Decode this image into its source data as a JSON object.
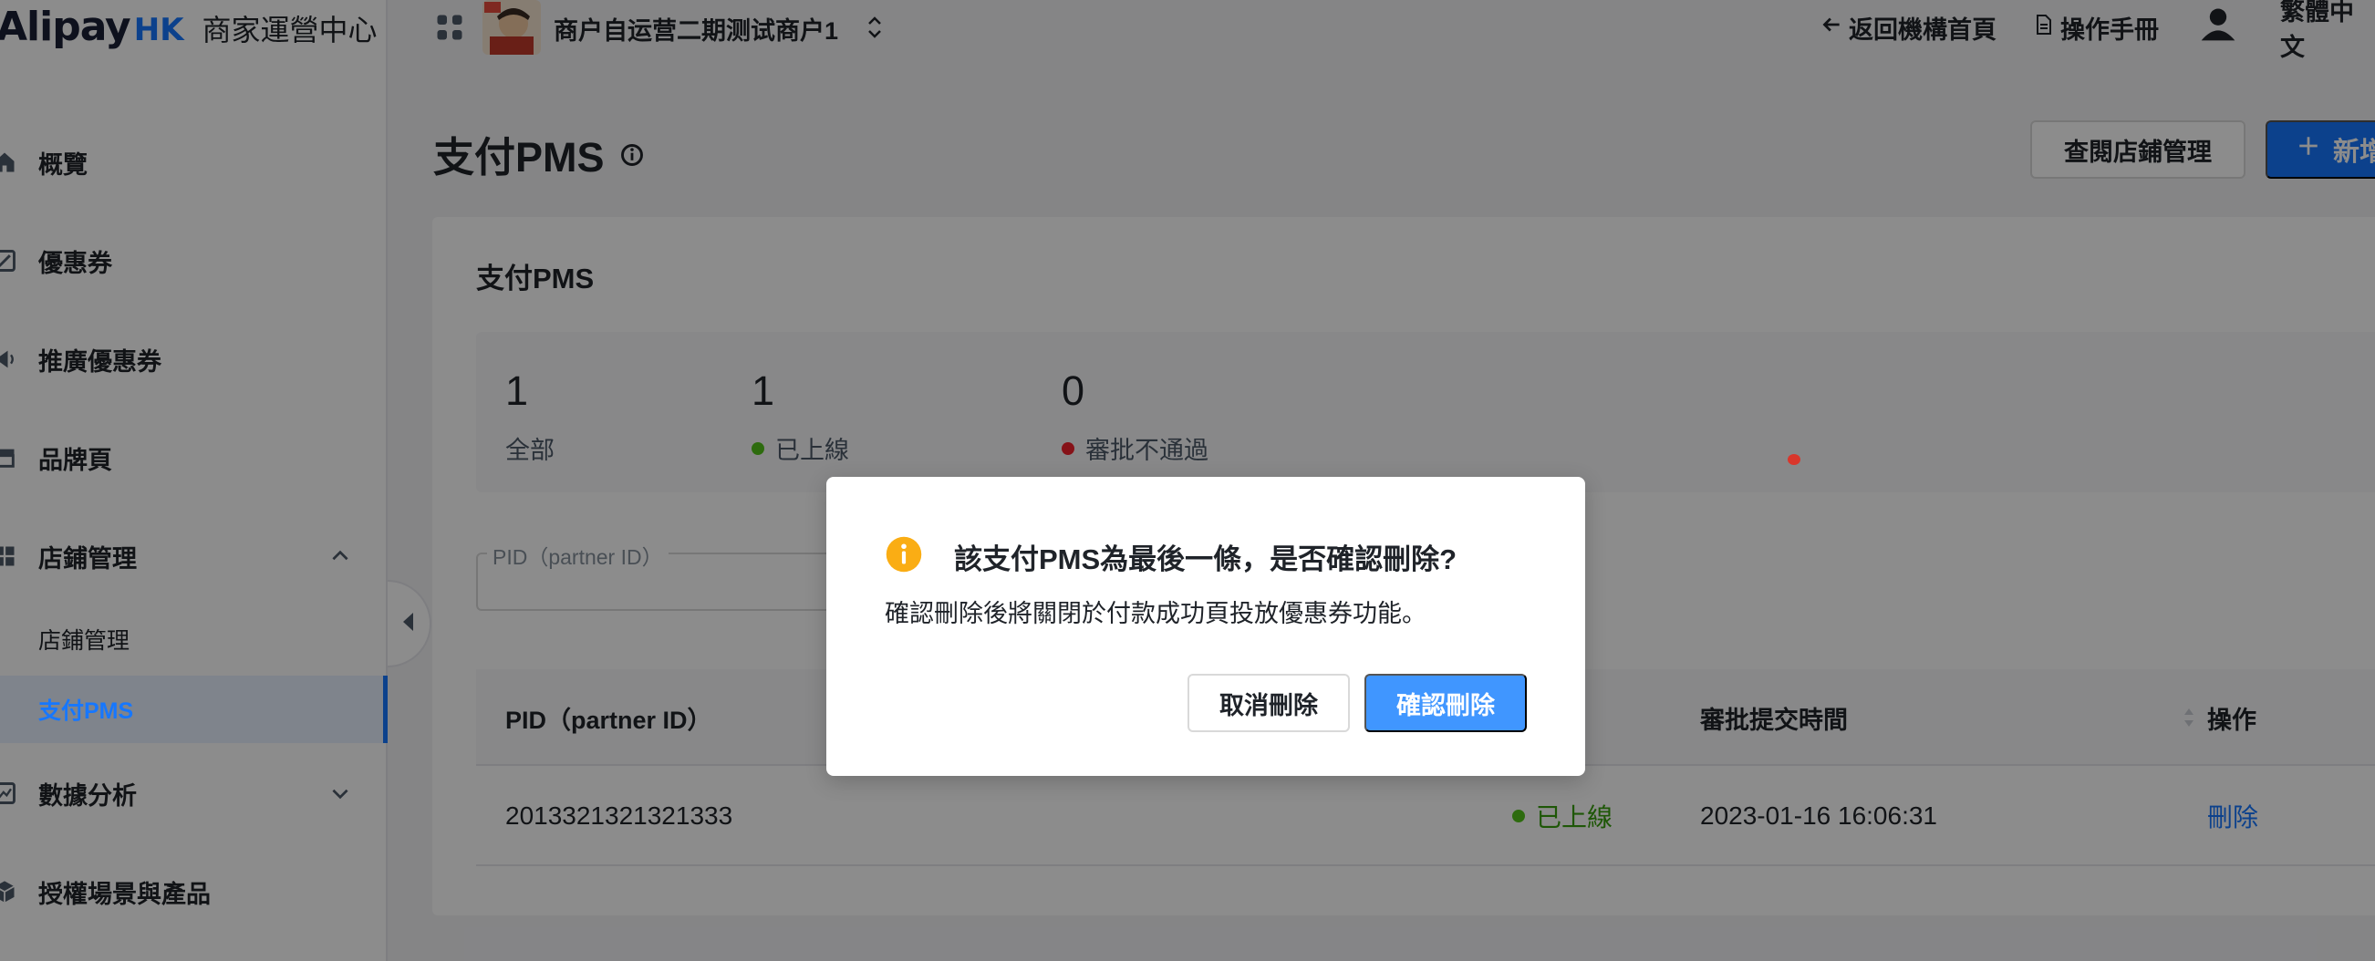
{
  "logo": {
    "brand": "Alipay",
    "region": "HK",
    "center_name": "商家運營中心"
  },
  "header": {
    "merchant_name": "商户自运营二期测试商户1",
    "back_link": "返回機構首頁",
    "manual_link": "操作手冊",
    "language": "繁體中文"
  },
  "sidebar": {
    "items": [
      {
        "label": "概覽",
        "icon": "home-icon"
      },
      {
        "label": "優惠券",
        "icon": "coupon-icon"
      },
      {
        "label": "推廣優惠券",
        "icon": "megaphone-icon"
      },
      {
        "label": "品牌頁",
        "icon": "store-icon"
      },
      {
        "label": "店鋪管理",
        "icon": "grid-icon",
        "expanded": true
      },
      {
        "label": "數據分析",
        "icon": "chart-icon",
        "expanded": false
      },
      {
        "label": "授權場景與產品",
        "icon": "cube-icon"
      }
    ],
    "sub_items": [
      {
        "label": "店鋪管理",
        "active": false
      },
      {
        "label": "支付PMS",
        "active": true
      }
    ]
  },
  "page": {
    "title": "支付PMS",
    "view_store_button": "查閱店鋪管理",
    "add_button": "新增"
  },
  "card": {
    "title": "支付PMS",
    "stats": [
      {
        "count": "1",
        "label": "全部",
        "dot_color": ""
      },
      {
        "count": "1",
        "label": "已上線",
        "dot_color": "#52c41a"
      },
      {
        "count": "0",
        "label": "審批不通過",
        "dot_color": "#f5222d"
      }
    ],
    "filter_label": "PID（partner ID）",
    "columns": [
      "PID（partner ID）",
      "審批提交時間",
      "操作"
    ],
    "rows": [
      {
        "pid": "2013321321321333",
        "status": "已上線",
        "submit_time": "2023-01-16 16:06:31",
        "action": "刪除"
      }
    ]
  },
  "modal": {
    "title": "該支付PMS為最後一條，是否確認刪除?",
    "content": "確認刪除後將關閉於付款成功頁投放優惠券功能。",
    "cancel_label": "取消刪除",
    "confirm_label": "確認刪除"
  },
  "colors": {
    "primary": "#1677ff",
    "success": "#52c41a",
    "error": "#f5222d",
    "warning": "#faad14"
  }
}
